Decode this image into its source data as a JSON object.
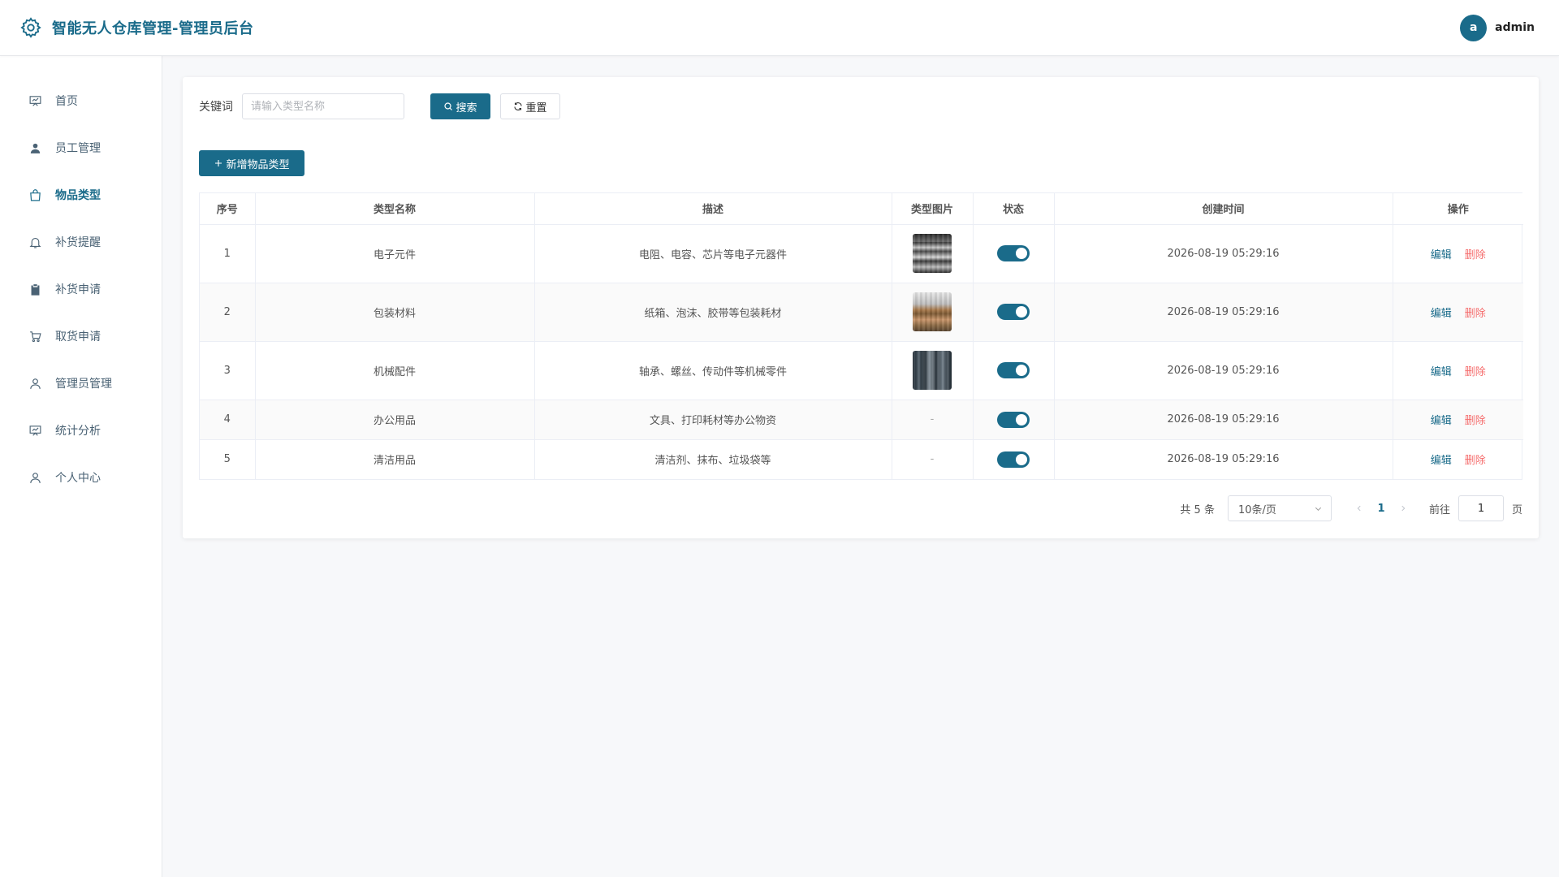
{
  "header": {
    "title": "智能无人仓库管理-管理员后台",
    "avatar_letter": "a",
    "username": "admin"
  },
  "sidebar": {
    "items": [
      {
        "label": "首页",
        "icon": "presentation-icon"
      },
      {
        "label": "员工管理",
        "icon": "user-solid-icon"
      },
      {
        "label": "物品类型",
        "icon": "bag-icon",
        "active": true
      },
      {
        "label": "补货提醒",
        "icon": "bell-icon"
      },
      {
        "label": "补货申请",
        "icon": "clipboard-icon"
      },
      {
        "label": "取货申请",
        "icon": "cart-icon"
      },
      {
        "label": "管理员管理",
        "icon": "user-icon"
      },
      {
        "label": "统计分析",
        "icon": "presentation-icon"
      },
      {
        "label": "个人中心",
        "icon": "user-icon"
      }
    ]
  },
  "filter": {
    "label": "关键词",
    "input_value": "",
    "input_placeholder": "请输入类型名称",
    "search_label": "搜索",
    "reset_label": "重置"
  },
  "actions": {
    "add_label": "新增物品类型"
  },
  "table": {
    "columns": [
      "序号",
      "类型名称",
      "描述",
      "类型图片",
      "状态",
      "创建时间",
      "操作"
    ],
    "rows": [
      {
        "index": "1",
        "name": "电子元件",
        "desc": "电阻、电容、芯片等电子元器件",
        "image": "thumb-electronics",
        "enabled": true,
        "created": "2026-08-19 05:29:16"
      },
      {
        "index": "2",
        "name": "包装材料",
        "desc": "纸箱、泡沫、胶带等包装耗材",
        "image": "thumb-packaging",
        "enabled": true,
        "created": "2026-08-19 05:29:16"
      },
      {
        "index": "3",
        "name": "机械配件",
        "desc": "轴承、螺丝、传动件等机械零件",
        "image": "thumb-mechanical",
        "enabled": true,
        "created": "2026-08-19 05:29:16"
      },
      {
        "index": "4",
        "name": "办公用品",
        "desc": "文具、打印耗材等办公物资",
        "image": "-",
        "enabled": true,
        "created": "2026-08-19 05:29:16"
      },
      {
        "index": "5",
        "name": "清洁用品",
        "desc": "清洁剂、抹布、垃圾袋等",
        "image": "-",
        "enabled": true,
        "created": "2026-08-19 05:29:16"
      }
    ],
    "edit_label": "编辑",
    "delete_label": "删除"
  },
  "pagination": {
    "total_text": "共 5 条",
    "page_size": "10条/页",
    "current_page": "1",
    "goto_label": "前往",
    "goto_value": "1",
    "page_suffix": "页"
  },
  "colors": {
    "primary": "#1a6b8a",
    "danger": "#f56c6c"
  }
}
